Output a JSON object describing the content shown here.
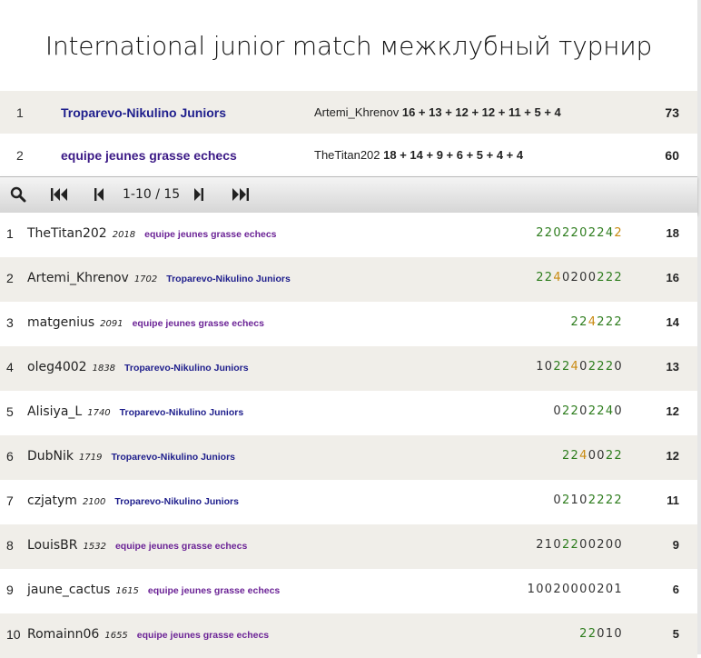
{
  "title": "International junior match межклубный турнир",
  "teams": [
    {
      "rank": "1",
      "name": "Troparevo-Nikulino Juniors",
      "leader": "Artemi_Khrenov",
      "scores": "16 + 13 + 12 + 12 + 11 + 5 + 4",
      "total": "73"
    },
    {
      "rank": "2",
      "name": "equipe jeunes grasse echecs",
      "leader": "TheTitan202",
      "scores": "18 + 14 + 9 + 6 + 5 + 4 + 4",
      "total": "60"
    }
  ],
  "pager": {
    "info": "1-10 / 15",
    "icons": [
      "search-icon",
      "first-page-icon",
      "prev-page-icon",
      "next-page-icon",
      "last-page-icon"
    ]
  },
  "players": [
    {
      "rank": "1",
      "user": "TheTitan202",
      "rating": "2018",
      "team": "equipe jeunes grasse echecs",
      "team_id": 2,
      "sheet": "2202202242",
      "sheet_colors": "gggggggggo",
      "total": "18"
    },
    {
      "rank": "2",
      "user": "Artemi_Khrenov",
      "rating": "1702",
      "team": "Troparevo-Nikulino Juniors",
      "team_id": 1,
      "sheet": "2240200222",
      "sheet_colors": "ggokkkkgggo",
      "total": "16"
    },
    {
      "rank": "3",
      "user": "matgenius",
      "rating": "2091",
      "team": "equipe jeunes grasse echecs",
      "team_id": 2,
      "sheet": "224222",
      "sheet_colors": "ggoggg",
      "total": "14"
    },
    {
      "rank": "4",
      "user": "oleg4002",
      "rating": "1838",
      "team": "Troparevo-Nikulino Juniors",
      "team_id": 1,
      "sheet": "1022402220",
      "sheet_colors": "kkggokgggk",
      "total": "13"
    },
    {
      "rank": "5",
      "user": "Alisiya_L",
      "rating": "1740",
      "team": "Troparevo-Nikulino Juniors",
      "team_id": 1,
      "sheet": "02202240",
      "sheet_colors": "kggkgggk",
      "total": "12"
    },
    {
      "rank": "6",
      "user": "DubNik",
      "rating": "1719",
      "team": "Troparevo-Nikulino Juniors",
      "team_id": 1,
      "sheet": "2240022",
      "sheet_colors": "ggokkgg",
      "total": "12"
    },
    {
      "rank": "7",
      "user": "czjatym",
      "rating": "2100",
      "team": "Troparevo-Nikulino Juniors",
      "team_id": 1,
      "sheet": "02102222",
      "sheet_colors": "kgkkgggg",
      "total": "11"
    },
    {
      "rank": "8",
      "user": "LouisBR",
      "rating": "1532",
      "team": "equipe jeunes grasse echecs",
      "team_id": 2,
      "sheet": "2102200200",
      "sheet_colors": "kkkggkkkkk",
      "total": "9"
    },
    {
      "rank": "9",
      "user": "jaune_cactus",
      "rating": "1615",
      "team": "equipe jeunes grasse echecs",
      "team_id": 2,
      "sheet": "10020000201",
      "sheet_colors": "kkkkkkkkkkk",
      "total": "6"
    },
    {
      "rank": "10",
      "user": "Romainn06",
      "rating": "1655",
      "team": "equipe jeunes grasse echecs",
      "team_id": 2,
      "sheet": "22010",
      "sheet_colors": "ggkkk",
      "total": "5"
    }
  ],
  "colors": {
    "team1": "#1e1e8c",
    "team2": "#6b2396",
    "win": "#2e7d1e",
    "berserk": "#c98a10",
    "row_alt": "#f0eee9"
  }
}
